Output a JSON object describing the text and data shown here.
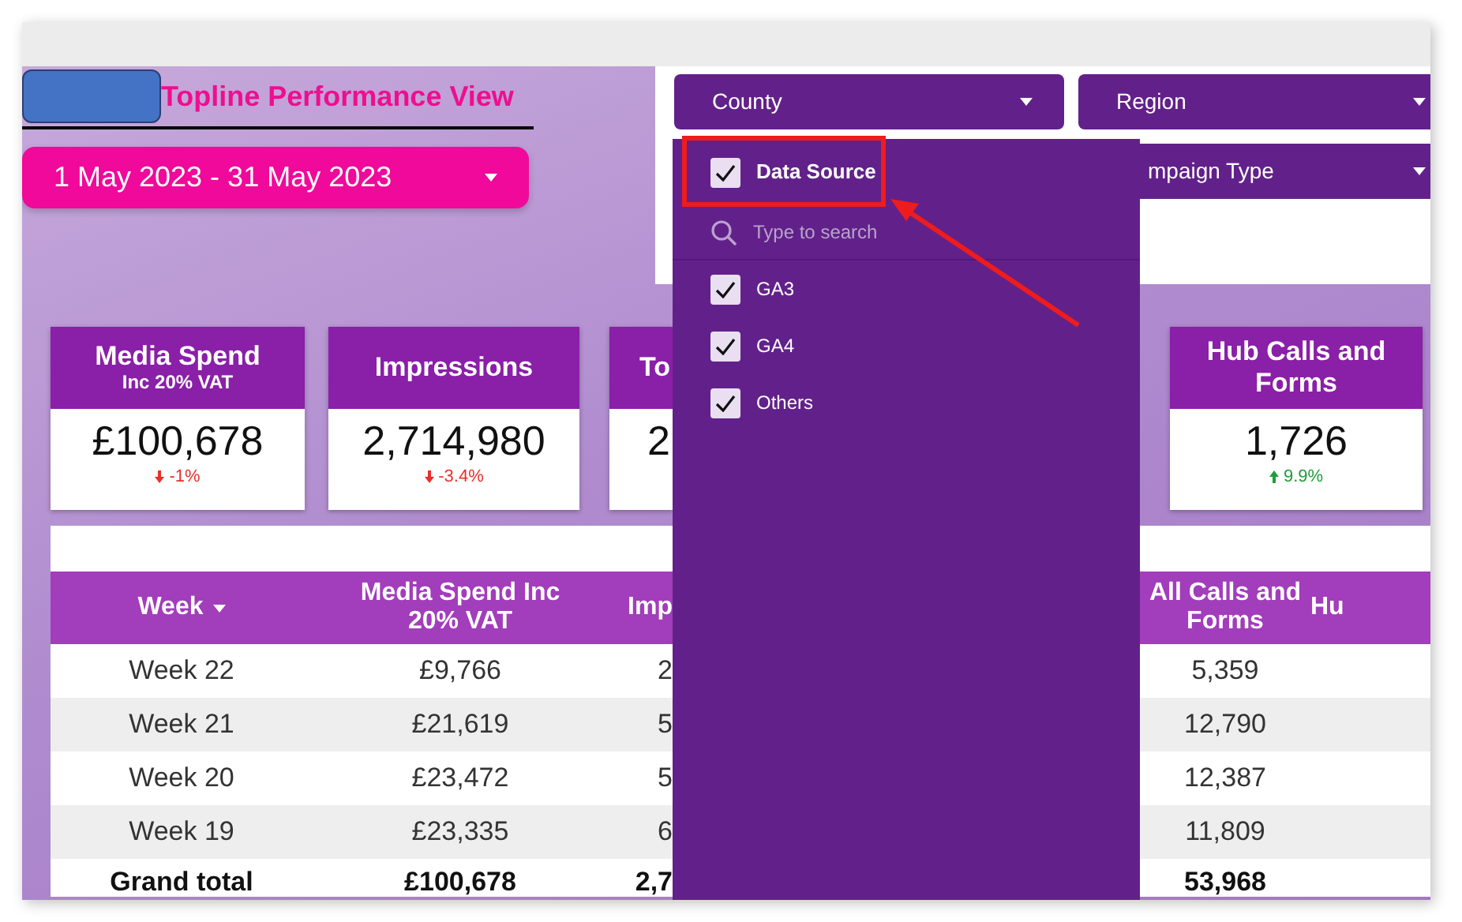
{
  "header": {
    "title": "Topline Performance View",
    "date_range": "1 May 2023 - 31 May 2023"
  },
  "filters": [
    {
      "label": "County"
    },
    {
      "label": "Region"
    },
    {
      "label": "mpaign Type"
    }
  ],
  "kpis": [
    {
      "title": "Media Spend",
      "subtitle": "Inc 20% VAT",
      "value": "£100,678",
      "delta": "-1%",
      "up": false
    },
    {
      "title": "Impressions",
      "value": "2,714,980",
      "delta": "-3.4%",
      "up": false
    },
    {
      "title": "To",
      "value": "2"
    },
    {
      "title": "Hub Calls and Forms",
      "value": "1,726",
      "delta": "9.9%",
      "up": true
    }
  ],
  "table": {
    "columns": [
      {
        "label": "Week",
        "sorted": true
      },
      {
        "label": "Media Spend Inc 20% VAT",
        "sorted": false
      },
      {
        "label": "Imp",
        "sorted": false
      },
      {
        "label": "All Calls and Forms",
        "sorted": false
      },
      {
        "label": "Hu",
        "sorted": false
      }
    ],
    "rows": [
      {
        "kind": "row",
        "cells": [
          "Week 22",
          "£9,766",
          "2",
          "5,359"
        ]
      },
      {
        "kind": "row",
        "cells": [
          "Week 21",
          "£21,619",
          "5",
          "12,790"
        ]
      },
      {
        "kind": "row",
        "cells": [
          "Week 20",
          "£23,472",
          "5",
          "12,387"
        ]
      },
      {
        "kind": "row",
        "cells": [
          "Week 19",
          "£23,335",
          "6",
          "11,809"
        ]
      },
      {
        "kind": "total",
        "cells": [
          "Grand total",
          "£100,678",
          "2,7",
          "53,968"
        ]
      }
    ]
  },
  "dropdown": {
    "title": "Data Source",
    "checked": true,
    "search_placeholder": "Type to search",
    "options": [
      {
        "label": "GA3",
        "checked": true
      },
      {
        "label": "GA4",
        "checked": true
      },
      {
        "label": "Others",
        "checked": true
      }
    ]
  }
}
